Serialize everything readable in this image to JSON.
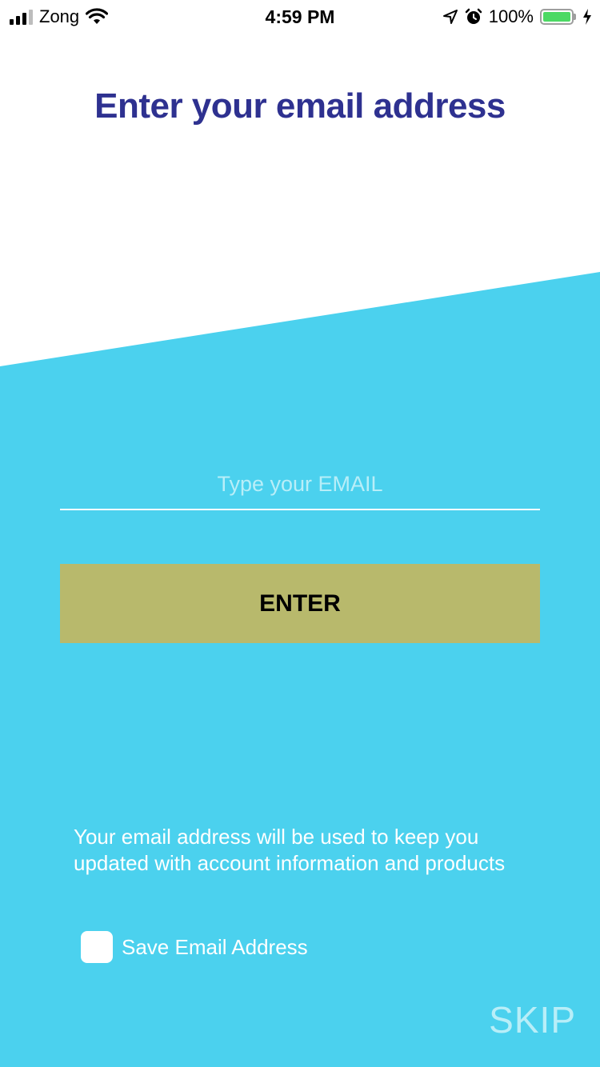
{
  "status_bar": {
    "carrier": "Zong",
    "time": "4:59 PM",
    "battery": "100%",
    "icons": [
      "signal-icon",
      "wifi-icon",
      "location-icon",
      "alarm-icon",
      "battery-icon",
      "charging-icon"
    ]
  },
  "title": "Enter your email address",
  "email_field": {
    "value": "",
    "placeholder": "Type your EMAIL"
  },
  "enter_button": {
    "label": "ENTER"
  },
  "info_text": "Your email address will be used to keep you updated with account information and products",
  "save_checkbox": {
    "label": "Save Email Address",
    "checked": false
  },
  "skip_label": "SKIP",
  "colors": {
    "accent": "#4bd1ee",
    "title": "#2e3190",
    "button": "#b8b96c",
    "skip": "#b8eef8"
  }
}
